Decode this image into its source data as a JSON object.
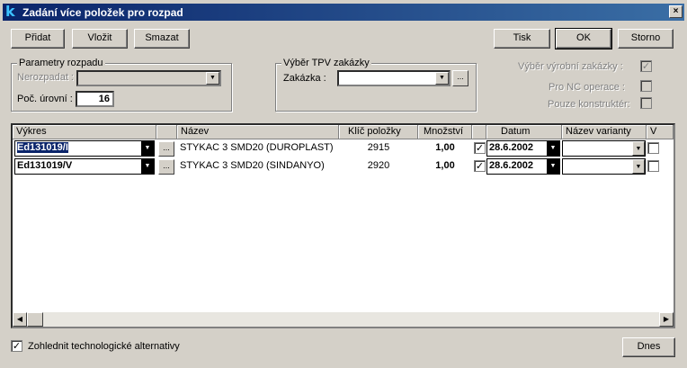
{
  "window": {
    "title": "Zadání více položek pro rozpad",
    "close_label": "×"
  },
  "toolbar": {
    "pridat": "Přidat",
    "vlozit": "Vložit",
    "smazat": "Smazat",
    "tisk": "Tisk",
    "ok": "OK",
    "storno": "Storno"
  },
  "params": {
    "group_label": "Parametry rozpadu",
    "nerozpadat_label": "Nerozpadat :",
    "nerozpadat_value": "",
    "levels_label": "Poč. úrovní :",
    "levels_value": "16"
  },
  "tpv": {
    "group_label": "Výběr TPV zakázky",
    "zakazka_label": "Zakázka :",
    "zakazka_value": ""
  },
  "options": {
    "vyrobni_label": "Výběr výrobní zakázky :",
    "vyrobni_checked": true,
    "nc_label": "Pro NC operace :",
    "nc_checked": false,
    "konstrukter_label": "Pouze konstruktér:",
    "konstrukter_checked": false
  },
  "grid": {
    "columns": [
      "Výkres",
      "",
      "Název",
      "Klíč položky",
      "Množství",
      "",
      "Datum",
      "Název varianty",
      "V"
    ],
    "rows": [
      {
        "vykres": "Ed131019/I",
        "nazev": "STYKAC 3 SMD20  (DUROPLAST)",
        "klic": "2915",
        "mnozstvi": "1,00",
        "checked": true,
        "datum": "28.6.2002",
        "varianta": "",
        "v": false
      },
      {
        "vykres": "Ed131019/V",
        "nazev": "STYKAC 3 SMD20  (SINDANYO)",
        "klic": "2920",
        "mnozstvi": "1,00",
        "checked": true,
        "datum": "28.6.2002",
        "varianta": "",
        "v": false
      }
    ]
  },
  "footer": {
    "alternativy_label": "Zohlednit technologické alternativy",
    "alternativy_checked": true,
    "dnes": "Dnes"
  },
  "icons": {
    "check": "✓",
    "dropdown": "▼",
    "ellipsis": "...",
    "left_arrow": "◀",
    "right_arrow": "▶",
    "app_logo": "k"
  },
  "colors": {
    "title_start": "#0a246a",
    "title_end": "#3a6ea5",
    "face": "#d4d0c8",
    "selection": "#0a246a"
  }
}
